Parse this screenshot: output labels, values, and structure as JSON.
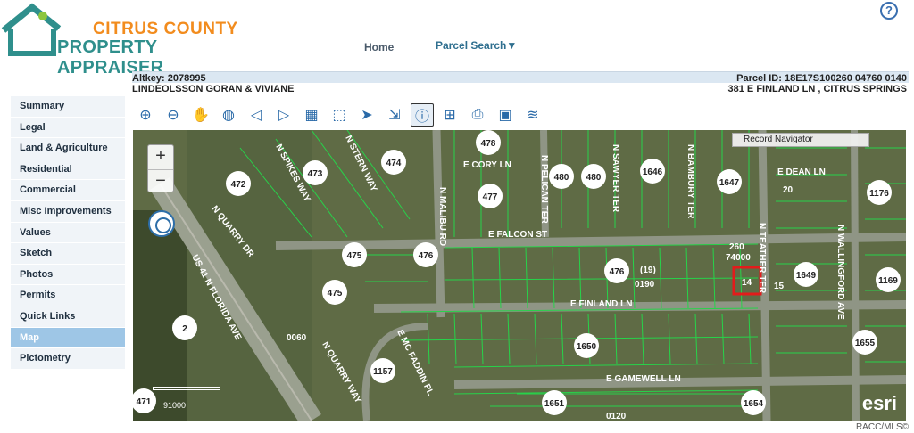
{
  "header": {
    "logo_line1": "CITRUS COUNTY",
    "logo_line2": "PROPERTY APPRAISER",
    "nav_home": "Home",
    "nav_parcel_search": "Parcel Search▼",
    "help_label": "?"
  },
  "parcel": {
    "altkey": "Altkey: 2078995",
    "parcel_id": "Parcel ID: 18E17S100260 04760 0140",
    "owner": "LINDEOLSSON GORAN & VIVIANE",
    "address": "381 E FINLAND LN , CITRUS SPRINGS"
  },
  "sidebar": {
    "items": [
      {
        "label": "Summary",
        "active": false
      },
      {
        "label": "Legal",
        "active": false
      },
      {
        "label": "Land & Agriculture",
        "active": false
      },
      {
        "label": "Residential",
        "active": false
      },
      {
        "label": "Commercial",
        "active": false
      },
      {
        "label": "Misc Improvements",
        "active": false
      },
      {
        "label": "Values",
        "active": false
      },
      {
        "label": "Sketch",
        "active": false
      },
      {
        "label": "Photos",
        "active": false
      },
      {
        "label": "Permits",
        "active": false
      },
      {
        "label": "Quick Links",
        "active": false
      },
      {
        "label": "Map",
        "active": true
      },
      {
        "label": "Pictometry",
        "active": false
      }
    ]
  },
  "toolbar": {
    "tools": [
      "zoom-in-icon",
      "zoom-out-icon",
      "pan-hand-icon",
      "globe-icon",
      "back-arrow-icon",
      "forward-arrow-icon",
      "layers-map-icon",
      "zoom-box-icon",
      "select-arrow-icon",
      "identify-arrow-icon",
      "info-icon",
      "measure-icon",
      "print-icon",
      "extent-icon",
      "stack-icon"
    ],
    "glyphs": [
      "⊕",
      "⊖",
      "✋",
      "◍",
      "◁",
      "▷",
      "▦",
      "⬚",
      "➤",
      "⇲",
      "ⓘ",
      "⊞",
      "⎙",
      "▣",
      "≋"
    ]
  },
  "map": {
    "zoom_in": "+",
    "zoom_out": "−",
    "record_navigator": "Record Navigator",
    "esri": "esri",
    "scale_label": "91000",
    "roads": [
      "E CORY LN",
      "E FALCON ST",
      "E FINLAND LN",
      "E GAMEWELL LN",
      "E DEAN LN",
      "N QUARRY DR",
      "N SPIKES WAY",
      "N STERN WAY",
      "N MALIBU RD",
      "N PELICAN TER",
      "N SAWYER TER",
      "N BAMBURY TER",
      "N TEATHER TER",
      "N WALLINGFORD AVE",
      "US 41 N FLORIDA AVE",
      "N QUARRY WAY",
      "E MC FADDIN PL"
    ],
    "blocks": [
      "472",
      "473",
      "474",
      "478",
      "477",
      "480",
      "480",
      "1646",
      "1647",
      "1176",
      "475",
      "476",
      "475",
      "476",
      "1649",
      "1169",
      "1650",
      "1157",
      "1655",
      "1651",
      "1654",
      "471",
      "2"
    ],
    "parcel_labels": [
      "260",
      "74000",
      "(19)",
      "0190",
      "14",
      "0060",
      "0120",
      "20",
      "15"
    ]
  },
  "watermark": "RACC/MLS©"
}
